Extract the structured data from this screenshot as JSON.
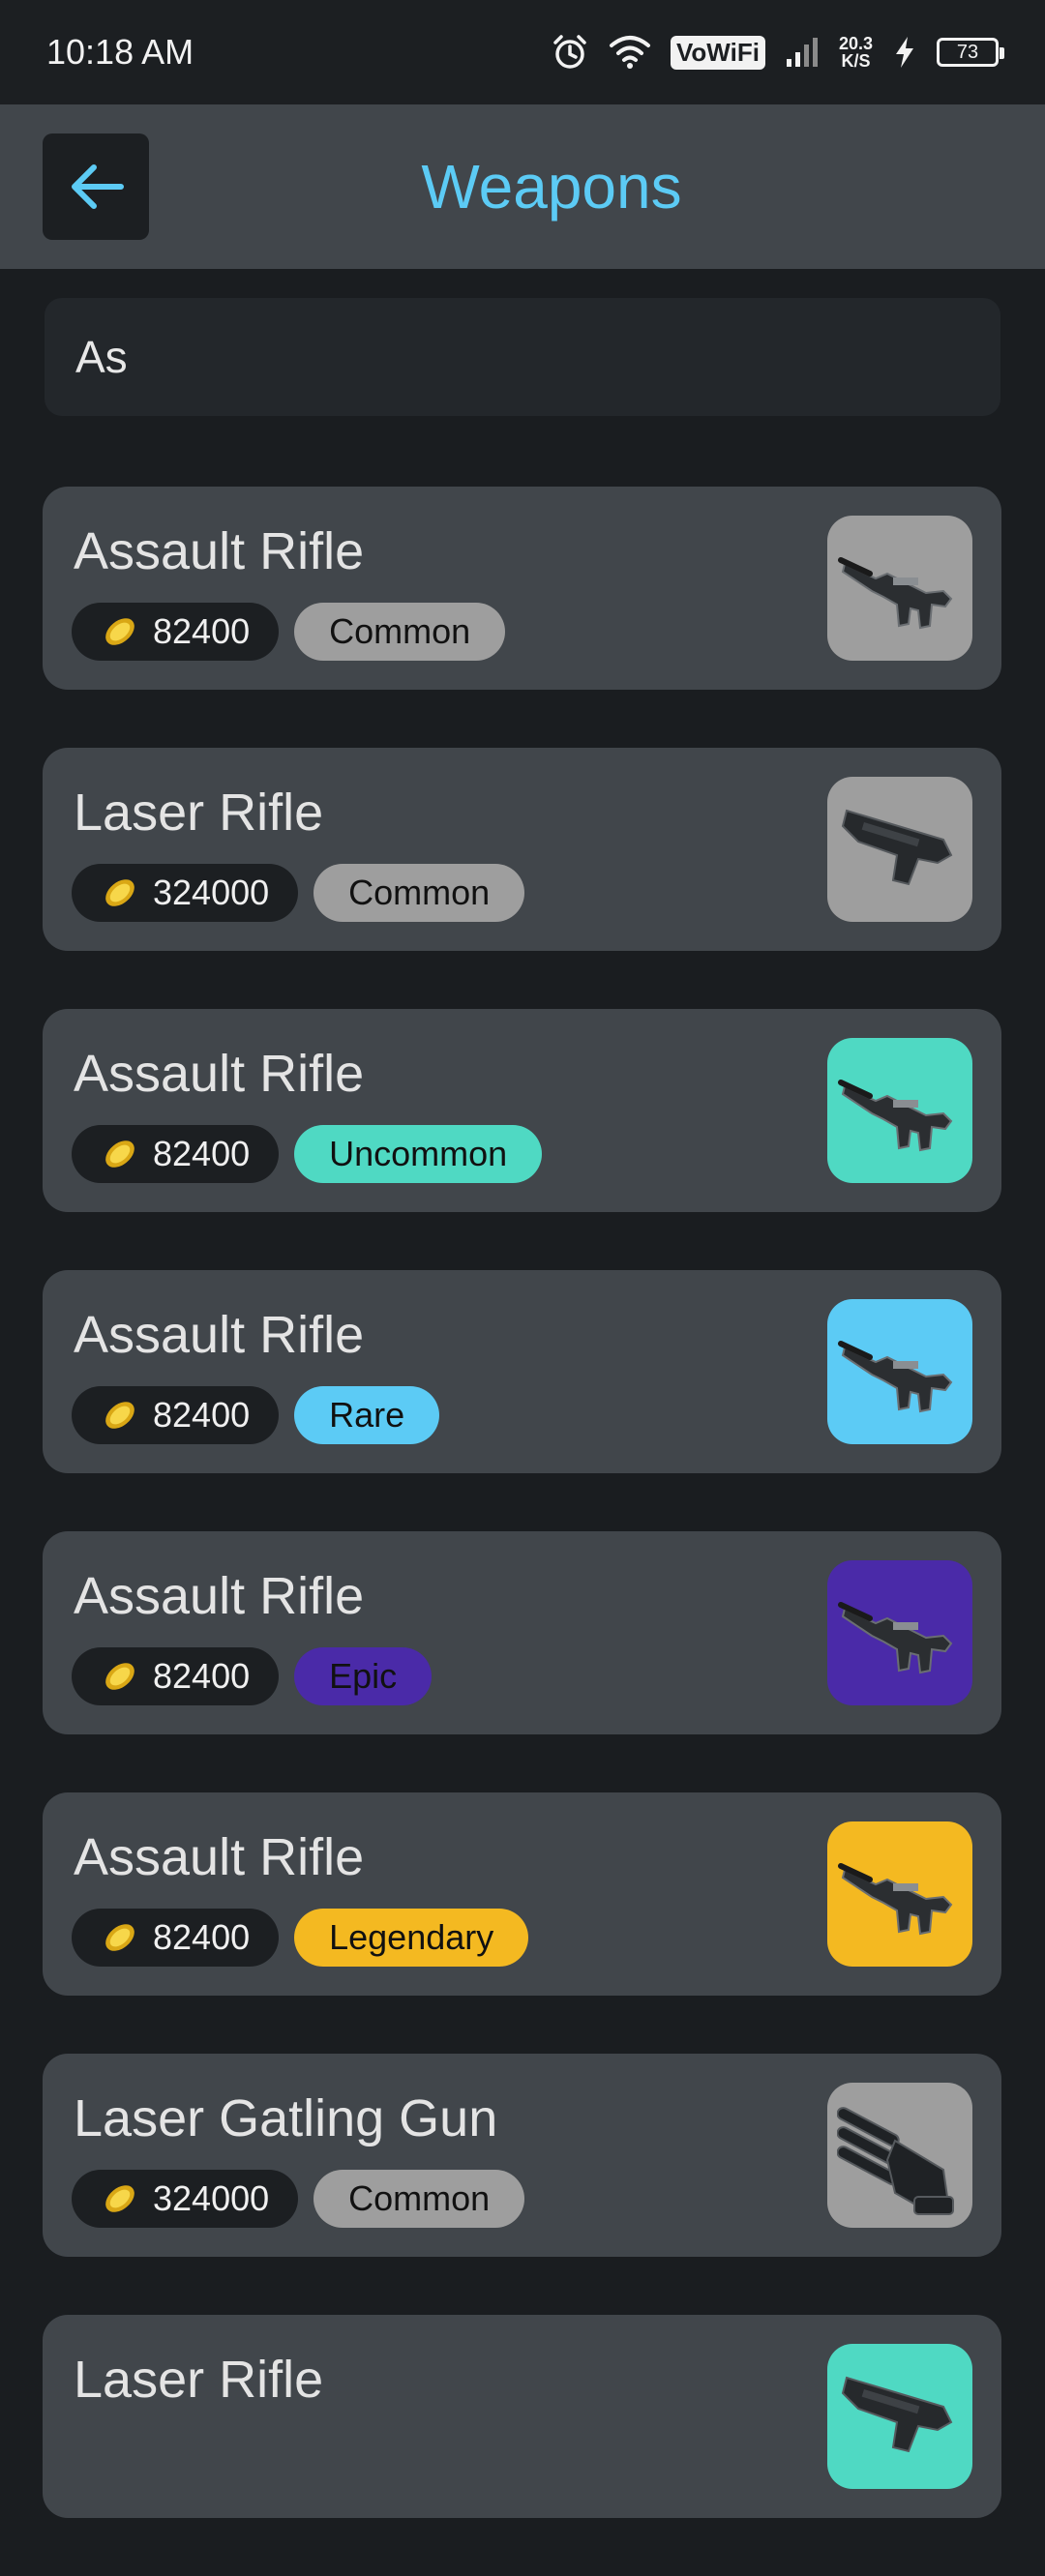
{
  "status_bar": {
    "time": "10:18 AM",
    "network_label": "VoWiFi",
    "speed_value": "20.3",
    "speed_unit": "K/S",
    "battery": "73"
  },
  "app_bar": {
    "title": "Weapons"
  },
  "search": {
    "value": "As"
  },
  "weapons": [
    {
      "name": "Assault Rifle",
      "price": "82400",
      "rarity": "Common",
      "color": "#9e9e9e",
      "icon": "rifle"
    },
    {
      "name": "Laser Rifle",
      "price": "324000",
      "rarity": "Common",
      "color": "#9e9e9e",
      "icon": "laser"
    },
    {
      "name": "Assault Rifle",
      "price": "82400",
      "rarity": "Uncommon",
      "color": "#4fd9c3",
      "icon": "rifle"
    },
    {
      "name": "Assault Rifle",
      "price": "82400",
      "rarity": "Rare",
      "color": "#5ccbf5",
      "icon": "rifle"
    },
    {
      "name": "Assault Rifle",
      "price": "82400",
      "rarity": "Epic",
      "color": "#4a2aa8",
      "icon": "rifle"
    },
    {
      "name": "Assault Rifle",
      "price": "82400",
      "rarity": "Legendary",
      "color": "#f4b921",
      "icon": "rifle"
    },
    {
      "name": "Laser Gatling Gun",
      "price": "324000",
      "rarity": "Common",
      "color": "#9e9e9e",
      "icon": "gatling"
    },
    {
      "name": "Laser Rifle",
      "price": "",
      "rarity": "",
      "color": "#4fd9c3",
      "icon": "laser"
    }
  ]
}
